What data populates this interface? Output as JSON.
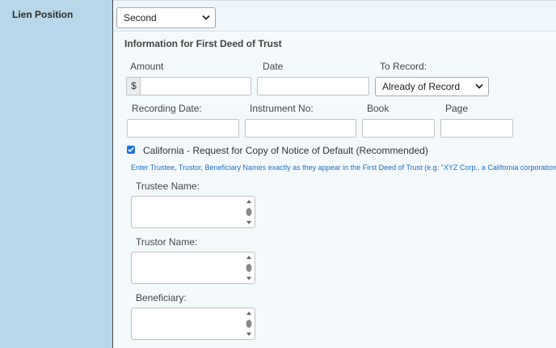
{
  "lien_position": {
    "label": "Lien Position",
    "selected": "Second"
  },
  "section": {
    "heading": "Information for First Deed of Trust"
  },
  "fields": {
    "amount_label": "Amount",
    "amount_prefix": "$",
    "date_label": "Date",
    "to_record_label": "To Record:",
    "to_record_selected": "Already of Record",
    "recording_date_label": "Recording Date:",
    "instrument_no_label": "Instrument No:",
    "book_label": "Book",
    "page_label": "Page"
  },
  "california": {
    "checkbox_label": "California - Request for Copy of Notice of Default (Recommended)",
    "checked": true,
    "hint": "Enter Trustee, Trustor, Beneficiary Names exactly as they appear in the First Deed of Trust (e.g. \"XYZ Corp., a California corporation\")"
  },
  "names": {
    "trustee_label": "Trustee Name:",
    "trustor_label": "Trustor Name:",
    "beneficiary_label": "Beneficiary:"
  },
  "colors": {
    "left_panel": "#b8d7e9",
    "accent": "#1a73d9",
    "hint_text": "#1a6fc7"
  }
}
